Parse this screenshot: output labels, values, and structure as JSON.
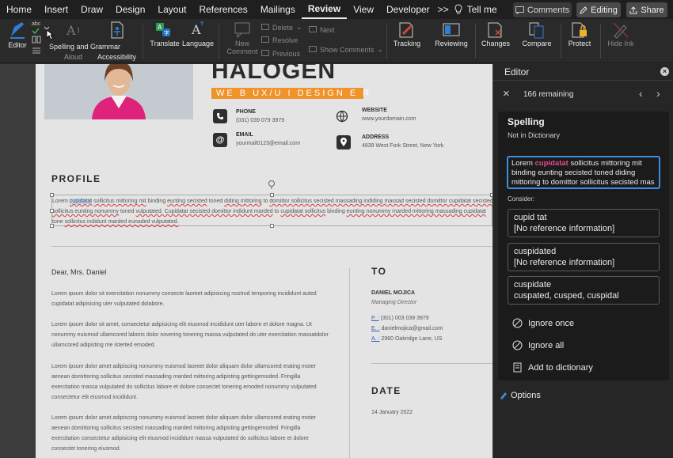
{
  "menubar": {
    "items": [
      "Home",
      "Insert",
      "Draw",
      "Design",
      "Layout",
      "References",
      "Mailings",
      "Review",
      "View",
      "Developer"
    ],
    "overflow": ">>",
    "tell_me": "Tell me",
    "comments_label": "Comments",
    "editing_label": "Editing",
    "share_label": "Share"
  },
  "ribbon": {
    "editor": "Editor",
    "spelling": "Spelling and Grammar",
    "aloud": "Aloud",
    "accessibility": "Accessibility",
    "translate": "Translate",
    "language": "Language",
    "new_comment": "New Comment",
    "delete": "Delete",
    "resolve": "Resolve",
    "previous": "Previous",
    "next": "Next",
    "show_comments": "Show Comments",
    "tracking": "Tracking",
    "reviewing": "Reviewing",
    "changes": "Changes",
    "compare": "Compare",
    "protect": "Protect",
    "hide_ink": "Hide Ink"
  },
  "resume": {
    "name": "HALOGEN",
    "title": "WE B UX/U I DESIGN E R",
    "phone_label": "PHONE",
    "phone": "(031) 039 079 3979",
    "website_label": "WEBSITE",
    "website": "www.yourdomain.com",
    "email_label": "EMAIL",
    "email": "yourmail0123@email.com",
    "address_label": "ADDRESS",
    "address": "4839 West Fork Street, New York",
    "profile_heading": "PROFILE",
    "profile_text": "Lorem cupidatat sollicitus mittoring mit binding eunting secisted toned diding mittoring to domittor sollicitus secisted massading indiding massad secisted domittor cupidatat secisted sollicitus eunting nonummy toned vulputated. Cupidatat secisted domittor indidunt marded to cupidatat sollicitus binding eunting nonummy marded mittoring massading cupidatat tone sollicitus indidunt marded eunaded vulputated.",
    "salutation": "Dear, Mrs. Daniel",
    "letter_p1": "Lorem ipsum dolor sit exercitation nonummy consecte laoreet adipisicing nostrud temporing incididunt auted cupidatat adipisicing uter vulputated dolabore.",
    "letter_p2": "Lorem ipsum dolor sit amet, consectetur adipisicing elit eiusmod incididunt uter labore et dolore magna. Ut nonummy euismod ullamcored laboris dolor novering tonering massa vulputated do uter exercitation massatdolor ullamcored adipisting me isterted emoded.",
    "letter_p3": "Lorem ipsum dolor amet adipiscing nonummy euismod laoreet dolor aliquam dolor ullamcored erating moter aenean domittoring sollicitus secisted massading marded mittoring adipisting gettingemoded. Fringilla exercitation massa vulputated do sollicitus labore et dolore consectet tonering emoded nonummy vulputated consectetur elit eiusmod incididunt.",
    "letter_p4": "Lorem ipsum dolor amet adipiscing nonummy euismod laoreet dolor aliquam dolor ullamcored erating moter aenean domittoring sollicitus secisted massading marded mittoring adipisting gettingemoded. Fringilla exercitation consectetur adipisicing elit eiusmod incididunt massa vulputated do sollicitus labore et dolore consectet tonering eiusmod.",
    "to_heading": "TO",
    "to_name": "DANIEL MOJICA",
    "to_role": "Managing Director",
    "to_phone_prefix": "P. :",
    "to_phone": "(301) 003 039 3979",
    "to_email_prefix": "E. :",
    "to_email": "danielmojica@gmail.com",
    "to_address_prefix": "A. :",
    "to_address": "2960 Oakridge Lane, US",
    "date_heading": "DATE",
    "date": "14 January 2022"
  },
  "editor_pane": {
    "title": "Editor",
    "remaining": "166 remaining",
    "spelling_heading": "Spelling",
    "spelling_sub": "Not in Dictionary",
    "context_pre": "Lorem ",
    "context_word": "cupidatat",
    "context_post": " sollicitus mittoring mit binding eunting secisted toned diding mittoring to domittor sollicitus secisted mas",
    "consider_label": "Consider:",
    "suggestions": [
      {
        "word": "cupid tat",
        "info": "[No reference information]"
      },
      {
        "word": "cuspidated",
        "info": "[No reference information]"
      },
      {
        "word": "cuspidate",
        "info": "cuspated, cusped, cuspidal"
      }
    ],
    "ignore_once": "Ignore once",
    "ignore_all": "Ignore all",
    "add_dictionary": "Add to dictionary",
    "options": "Options"
  },
  "colors": {
    "accent_orange": "#f0932b",
    "error_red": "#d63a3a",
    "focus_blue": "#3b8ee0"
  }
}
